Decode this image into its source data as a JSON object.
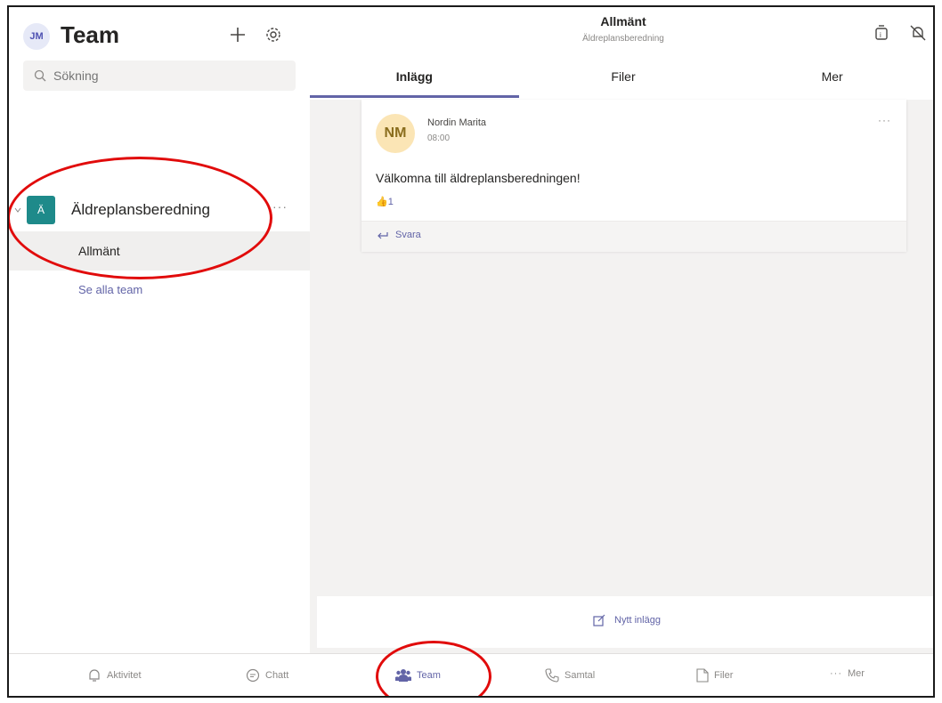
{
  "user": {
    "initials": "JM"
  },
  "sidebar": {
    "title": "Team",
    "search_placeholder": "Sökning",
    "team": {
      "avatar_letter": "Ä",
      "name": "Äldreplansberedning",
      "more": "···"
    },
    "channel": {
      "name": "Allmänt"
    },
    "see_all": "Se alla team"
  },
  "channel_header": {
    "title": "Allmänt",
    "subtitle": "Äldreplansberedning",
    "tabs": [
      {
        "label": "Inlägg",
        "active": true
      },
      {
        "label": "Filer",
        "active": false
      },
      {
        "label": "Mer",
        "active": false
      }
    ]
  },
  "post": {
    "avatar_initials": "NM",
    "author": "Nordin Marita",
    "time": "08:00",
    "more": "···",
    "body": "Välkomna till äldreplansberedningen!",
    "reaction_count": "1",
    "reply_label": "Svara"
  },
  "compose": {
    "new_post_label": "Nytt inlägg"
  },
  "bottom_nav": [
    {
      "label": "Aktivitet",
      "icon": "bell-icon",
      "active": false
    },
    {
      "label": "Chatt",
      "icon": "chat-icon",
      "active": false
    },
    {
      "label": "Team",
      "icon": "teams-icon",
      "active": true
    },
    {
      "label": "Samtal",
      "icon": "phone-icon",
      "active": false
    },
    {
      "label": "Filer",
      "icon": "file-icon",
      "active": false
    },
    {
      "label": "Mer",
      "icon": "more-icon",
      "active": false
    }
  ],
  "colors": {
    "accent": "#6264a7",
    "team_avatar": "#1e8a8a",
    "annotation": "#e10b0b"
  }
}
